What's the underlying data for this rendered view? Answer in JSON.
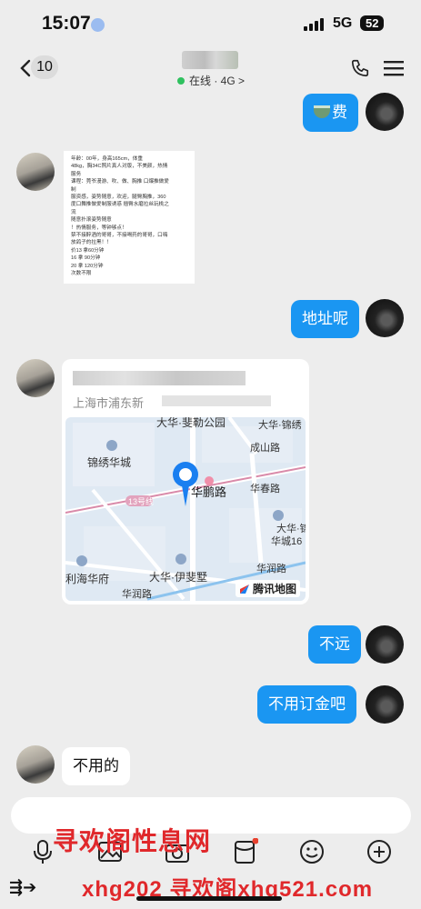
{
  "status_bar": {
    "time": "15:07",
    "network": "5G",
    "battery": "52"
  },
  "header": {
    "back_count": "10",
    "presence": "在线 · 4G >"
  },
  "messages": {
    "m1": "费",
    "m3": "地址呢",
    "m5": "不远",
    "m6": "不用订金吧",
    "m7": "不用的"
  },
  "rules_card": {
    "lines": [
      "年龄：00年，身高165cm，体重",
      "48kg，胸34C照片真人对版，不美颜，热情",
      "服务",
      "课程：莞爷漫游、吹、做、胸推 口爆推做爱",
      "制",
      "服资感，姿势随意，欢迎，腿臀胸推，360",
      "度口舞推做爱制服诱惑 翘臀水磨拉丝玩桃之",
      "流",
      "随意扑滚姿势随意",
      "！热情服务，等钟够点！",
      "禁不接醉酒的哥哥，不接喝药的哥哥，口嗨",
      "放鸽子的拉黑！！",
      "价13 拿60分钟",
      "16 拿 90分钟",
      "20 拿 120分钟",
      "次数不限"
    ]
  },
  "location_card": {
    "address": "上海市浦东新",
    "map": {
      "labels": {
        "park": "大华·斐勒公园",
        "community1": "锦绣华城",
        "road_main": "华鹏路",
        "road_chengshan": "成山路",
        "road_huachun": "华春路",
        "road_jinxiu": "大华·锦绣",
        "line13": "13号线",
        "community2": "大华·锦",
        "community2b": "华城16",
        "community3": "利海华府",
        "community4": "大华·伊斐墅",
        "road_huarun": "华润路",
        "road_huarun2": "华润路"
      },
      "provider": "腾讯地图"
    }
  },
  "watermarks": {
    "top": "寻欢阁性息网",
    "bottom": "xhg202 寻欢阁xhg521.com"
  }
}
